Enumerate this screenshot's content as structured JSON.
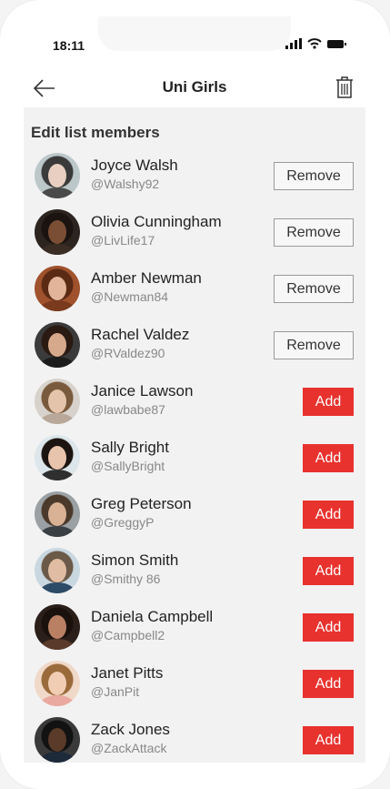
{
  "status_bar": {
    "time": "18:11"
  },
  "header": {
    "title": "Uni Girls"
  },
  "section_title": "Edit list members",
  "members": [
    {
      "name": "Joyce Walsh",
      "handle": "@Walshy92",
      "action": "Remove",
      "avatar": {
        "bg": "#bcc7c9",
        "hair": "#3a3a3a",
        "skin": "#e8cfc2",
        "top": "#4a4a4a"
      }
    },
    {
      "name": "Olivia Cunningham",
      "handle": "@LivLife17",
      "action": "Remove",
      "avatar": {
        "bg": "#2c241f",
        "hair": "#1a130f",
        "skin": "#7a4e35",
        "top": "#3b2d24"
      }
    },
    {
      "name": "Amber Newman",
      "handle": "@Newman84",
      "action": "Remove",
      "avatar": {
        "bg": "#a0522d",
        "hair": "#5a2a14",
        "skin": "#e2b59a",
        "top": "#7a3a1e"
      }
    },
    {
      "name": "Rachel Valdez",
      "handle": "@RValdez90",
      "action": "Remove",
      "avatar": {
        "bg": "#3b3b3b",
        "hair": "#2a1a12",
        "skin": "#d7a98c",
        "top": "#1c1c1c"
      }
    },
    {
      "name": "Janice Lawson",
      "handle": "@lawbabe87",
      "action": "Add",
      "avatar": {
        "bg": "#d8d2cc",
        "hair": "#7a5a3c",
        "skin": "#e4c4aa",
        "top": "#b9a89a"
      }
    },
    {
      "name": "Sally Bright",
      "handle": "@SallyBright",
      "action": "Add",
      "avatar": {
        "bg": "#dde6ea",
        "hair": "#1b1410",
        "skin": "#e8c4ad",
        "top": "#2f2f2f"
      }
    },
    {
      "name": "Greg Peterson",
      "handle": "@GreggyP",
      "action": "Add",
      "avatar": {
        "bg": "#9aa0a3",
        "hair": "#4b3a2c",
        "skin": "#d9b295",
        "top": "#3a3f44"
      }
    },
    {
      "name": "Simon Smith",
      "handle": "@Smithy 86",
      "action": "Add",
      "avatar": {
        "bg": "#c9d7e0",
        "hair": "#6b5a48",
        "skin": "#e0bca2",
        "top": "#2d4a66"
      }
    },
    {
      "name": "Daniela Campbell",
      "handle": "@Campbell2",
      "action": "Add",
      "avatar": {
        "bg": "#2b1f1a",
        "hair": "#1a110d",
        "skin": "#b98064",
        "top": "#5a3a2a"
      }
    },
    {
      "name": "Janet Pitts",
      "handle": "@JanPit",
      "action": "Add",
      "avatar": {
        "bg": "#f0d9c8",
        "hair": "#9a6a3a",
        "skin": "#f1cdb3",
        "top": "#e9a9a0"
      }
    },
    {
      "name": "Zack Jones",
      "handle": "@ZackAttack",
      "action": "Add",
      "avatar": {
        "bg": "#3a3a3a",
        "hair": "#121212",
        "skin": "#5a3a28",
        "top": "#1d2a3a"
      }
    }
  ],
  "colors": {
    "add_button": "#e8322e",
    "content_bg": "#f2f2f2"
  },
  "icons": {
    "back": "arrow-left-icon",
    "delete": "trash-icon"
  }
}
